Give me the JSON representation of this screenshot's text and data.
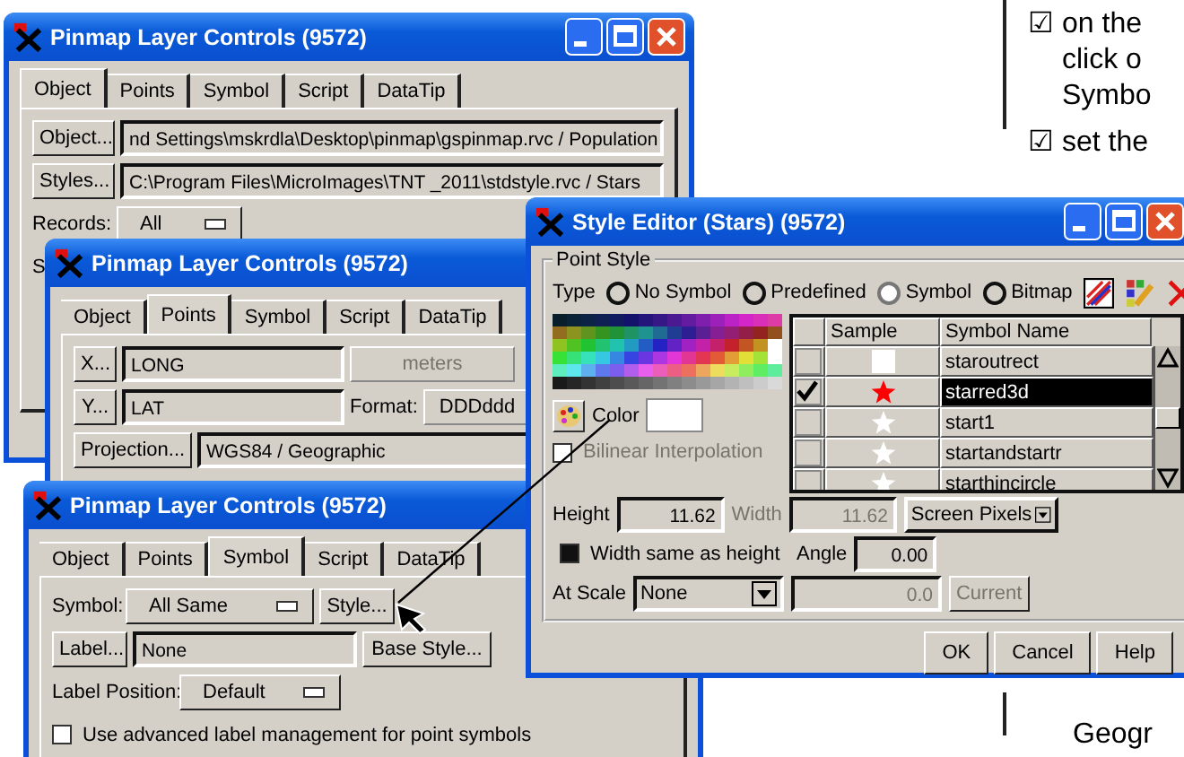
{
  "windows": [
    {
      "title": "Pinmap Layer Controls (9572)",
      "tabs": [
        {
          "label": "Object",
          "selected": true
        },
        {
          "label": "Points",
          "selected": false
        },
        {
          "label": "Symbol",
          "selected": false
        },
        {
          "label": "Script",
          "selected": false
        },
        {
          "label": "DataTip",
          "selected": false
        }
      ],
      "rows": [
        [
          {
            "kind": "button",
            "text": "Object..."
          },
          {
            "kind": "field",
            "text": "nd Settings\\mskrdla\\Desktop\\pinmap\\gspinmap.rvc / Population"
          }
        ],
        [
          {
            "kind": "button",
            "text": "Styles..."
          },
          {
            "kind": "field",
            "text": "C:\\Program Files\\MicroImages\\TNT _2011\\stdstyle.rvc / Stars"
          }
        ],
        [
          {
            "kind": "label",
            "text": "Records:"
          },
          {
            "kind": "dropdown",
            "text": "All"
          }
        ],
        [
          {
            "kind": "label",
            "text": "S"
          }
        ]
      ]
    },
    {
      "title": "Pinmap Layer Controls (9572)",
      "tabs": [
        {
          "label": "Object",
          "selected": false
        },
        {
          "label": "Points",
          "selected": true
        },
        {
          "label": "Symbol",
          "selected": false
        },
        {
          "label": "Script",
          "selected": false
        },
        {
          "label": "DataTip",
          "selected": false
        }
      ],
      "rows": [
        [
          {
            "kind": "button",
            "text": "X..."
          },
          {
            "kind": "field",
            "text": "LONG"
          },
          {
            "kind": "readout",
            "text": "meters"
          }
        ],
        [
          {
            "kind": "button",
            "text": "Y..."
          },
          {
            "kind": "field",
            "text": "LAT"
          },
          {
            "kind": "label",
            "text": "Format:"
          },
          {
            "kind": "readout_plain",
            "text": "DDDddd"
          }
        ],
        [
          {
            "kind": "button",
            "text": "Projection..."
          },
          {
            "kind": "field",
            "text": "WGS84 / Geographic"
          }
        ]
      ]
    },
    {
      "title": "Pinmap Layer Controls (9572)",
      "tabs": [
        {
          "label": "Object",
          "selected": false
        },
        {
          "label": "Points",
          "selected": false
        },
        {
          "label": "Symbol",
          "selected": true
        },
        {
          "label": "Script",
          "selected": false
        },
        {
          "label": "DataTip",
          "selected": false
        }
      ],
      "rows": [
        [
          {
            "kind": "label",
            "text": "Symbol:"
          },
          {
            "kind": "dropdown",
            "text": "All Same"
          },
          {
            "kind": "button",
            "text": "Style..."
          }
        ],
        [
          {
            "kind": "button",
            "text": "Label..."
          },
          {
            "kind": "field",
            "text": "None"
          },
          {
            "kind": "button",
            "text": "Base Style..."
          }
        ],
        [
          {
            "kind": "label",
            "text": "Label Position:"
          },
          {
            "kind": "dropdown",
            "text": "Default"
          }
        ],
        [
          {
            "kind": "checkbox",
            "text": "Use advanced label management for point symbols",
            "checked": false
          }
        ]
      ]
    }
  ],
  "style_editor": {
    "title": "Style Editor (Stars) (9572)",
    "group": "Point Style",
    "type_label": "Type",
    "types": [
      {
        "label": "No Symbol",
        "selected": false
      },
      {
        "label": "Predefined",
        "selected": false
      },
      {
        "label": "Symbol",
        "selected": true
      },
      {
        "label": "Bitmap",
        "selected": false
      }
    ],
    "color_label": "Color",
    "bilinear": {
      "label": "Bilinear Interpolation",
      "checked": false,
      "disabled": true
    },
    "columns": [
      "Sample",
      "Symbol Name"
    ],
    "symbols": [
      {
        "name": "staroutrect",
        "kind": "square",
        "color": "#ffffff",
        "checked": false,
        "selected": false
      },
      {
        "name": "starred3d",
        "kind": "star",
        "color": "#ff0000",
        "checked": true,
        "selected": true
      },
      {
        "name": "start1",
        "kind": "star",
        "color": "#ffffff",
        "checked": false,
        "selected": false
      },
      {
        "name": "startandstartr",
        "kind": "star",
        "color": "#ffffff",
        "checked": false,
        "selected": false
      },
      {
        "name": "starthincircle",
        "kind": "star",
        "color": "#ffffff",
        "checked": false,
        "selected": false
      }
    ],
    "height": {
      "label": "Height",
      "value": "11.62"
    },
    "width": {
      "label": "Width",
      "value": "11.62",
      "disabled": true
    },
    "units": "Screen Pixels",
    "same": {
      "label": "Width same as height",
      "checked": true
    },
    "angle": {
      "label": "Angle",
      "value": "0.00"
    },
    "scale": {
      "label": "At Scale",
      "value": "None"
    },
    "scale_value": {
      "value": "0.0",
      "disabled": true
    },
    "current": {
      "label": "Current",
      "disabled": true
    },
    "buttons": [
      "OK",
      "Cancel",
      "Help"
    ]
  },
  "document": {
    "bullets": [
      {
        "mark": "☑",
        "lines": [
          "on the",
          "click o",
          "Symbo"
        ]
      },
      {
        "mark": "☑",
        "lines": [
          "set the"
        ]
      }
    ],
    "footer": "Geogr"
  }
}
